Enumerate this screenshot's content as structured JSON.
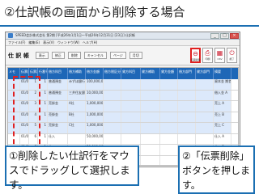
{
  "slide": {
    "title": "②仕訳帳の画面から削除する場合"
  },
  "app": {
    "titlebar_text": "SPEED会計株式会社 第2期 [平成26年1月1日～平成26年12月31日 [23日] 仕訳帳",
    "win_buttons": [
      "_",
      "□",
      "×"
    ],
    "menu": [
      "ファイル(F)",
      "編集(E)",
      "表示(V)",
      "ウィンドウ(W)",
      "ヘルプ(H)"
    ],
    "form_caption": "仕 訳 帳",
    "toolbar_buttons": [
      "表示",
      "修正",
      "削除",
      "キャンセル",
      "ページ",
      "月切"
    ],
    "toolbar_icons": [
      {
        "glyph": "⊖",
        "label": "伝票削除",
        "highlighted": true
      },
      {
        "glyph": "⎙",
        "label": "印刷",
        "highlighted": false
      },
      {
        "glyph": "▦",
        "label": "CSV",
        "highlighted": false
      },
      {
        "glyph": "⏻",
        "label": "終了",
        "highlighted": false
      }
    ]
  },
  "grid": {
    "headers": [
      "メモ",
      "伝票日付",
      "伝票番号",
      "行番号",
      "借方科目",
      "借方補助",
      "借方金額",
      "借方税区分",
      "貸方科目",
      "貸方補助",
      "貸方金額",
      "借方部門",
      "貸方部門",
      "摘要"
    ],
    "rows": [
      {
        "selected": true,
        "cells": [
          "",
          "01/01",
          "1",
          "1",
          "普通預金",
          "みずほ銀行",
          "100,000,000",
          "",
          "",
          "",
          "",
          "",
          "",
          "資本金 期首"
        ]
      },
      {
        "selected": true,
        "cells": [
          "",
          "01/01",
          "2",
          "1",
          "普通預金",
          "三井住友銀行",
          "10,000,000",
          "",
          "",
          "",
          "",
          "",
          "",
          "借入金 A"
        ]
      },
      {
        "selected": true,
        "cells": [
          "",
          "01/01",
          "3",
          "1",
          "売掛金",
          "A社",
          "1,000,000",
          "",
          "",
          "",
          "",
          "",
          "",
          "売上 A"
        ]
      },
      {
        "selected": true,
        "cells": [
          "",
          "01/01",
          "4",
          "1",
          "売掛金",
          "B社",
          "1,000,000",
          "",
          "",
          "",
          "",
          "",
          "",
          "売上 B"
        ]
      },
      {
        "selected": true,
        "cells": [
          "",
          "01/01",
          "5",
          "1",
          "売掛金",
          "C社",
          "1,000,000",
          "",
          "",
          "",
          "",
          "",
          "",
          "売上 C"
        ]
      },
      {
        "selected": false,
        "cells": [
          "",
          "01/01",
          "6",
          "1",
          "仕入",
          "",
          "50,000,000",
          "",
          "",
          "",
          "",
          "",
          "",
          "仕入 A"
        ]
      },
      {
        "selected": false,
        "cells": [
          "",
          "01/01",
          "7",
          "1",
          "仕入",
          "",
          "50,000,000",
          "",
          "",
          "",
          "",
          "",
          "",
          "仕入 B"
        ]
      },
      {
        "selected": false,
        "cells": [
          "",
          "01/01",
          "8",
          "1",
          "旅費交通費",
          "",
          "10,000",
          "",
          "",
          "",
          "",
          "",
          "",
          "交通費"
        ]
      }
    ]
  },
  "callouts": {
    "left": "①削除したい仕訳行をマウスでドラッグして選択します。",
    "right": "②「伝票削除」ボタンを押します。"
  },
  "colors": {
    "accent": "#1b6fb2",
    "grid_header": "#1e67b7",
    "highlight": "#e02020",
    "selected_row": "#dce9fb"
  }
}
